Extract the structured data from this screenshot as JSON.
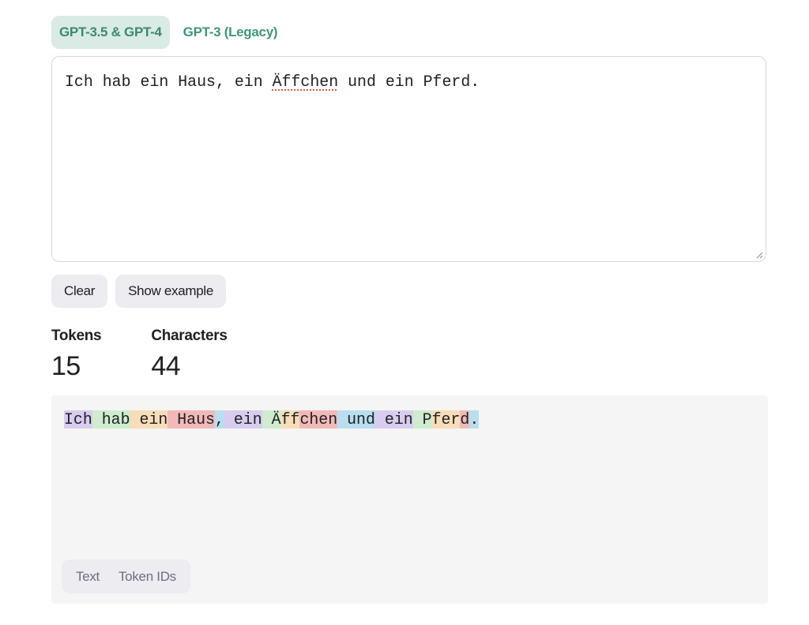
{
  "tabs": [
    {
      "label": "GPT-3.5 & GPT-4",
      "active": true
    },
    {
      "label": "GPT-3 (Legacy)",
      "active": false
    }
  ],
  "editor": {
    "text_before": "Ich hab ein Haus, ein ",
    "misspelled": "Äffchen",
    "text_after": " und ein Pferd."
  },
  "buttons": {
    "clear": "Clear",
    "show_example": "Show example"
  },
  "stats": {
    "tokens_label": "Tokens",
    "tokens_value": "15",
    "characters_label": "Characters",
    "characters_value": "44"
  },
  "tokens": [
    {
      "text": "Ich",
      "color": "#d8ccef"
    },
    {
      "text": " hab",
      "color": "#cfeccf"
    },
    {
      "text": " ein",
      "color": "#f7ddb8"
    },
    {
      "text": " Haus",
      "color": "#f2b9b9"
    },
    {
      "text": ",",
      "color": "#b9def0"
    },
    {
      "text": " ein",
      "color": "#d8ccef"
    },
    {
      "text": " Ä",
      "color": "#cfeccf"
    },
    {
      "text": "ff",
      "color": "#f7ddb8"
    },
    {
      "text": "chen",
      "color": "#f2b9b9"
    },
    {
      "text": " und",
      "color": "#b9def0"
    },
    {
      "text": " ein",
      "color": "#d8ccef"
    },
    {
      "text": " P",
      "color": "#cfeccf"
    },
    {
      "text": "fer",
      "color": "#f7ddb8"
    },
    {
      "text": "d",
      "color": "#f2b9b9"
    },
    {
      "text": ".",
      "color": "#b9def0"
    }
  ],
  "view_toggle": {
    "text": "Text",
    "token_ids": "Token IDs"
  }
}
